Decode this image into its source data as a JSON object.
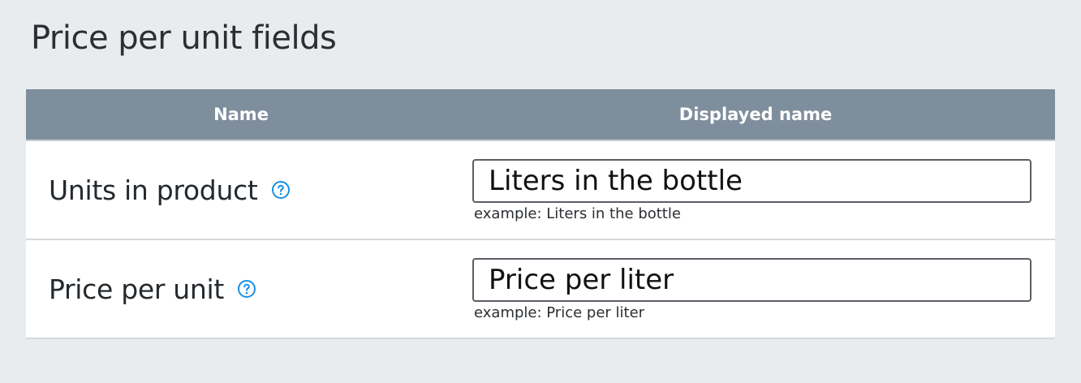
{
  "page": {
    "title": "Price per unit fields"
  },
  "table": {
    "columns": {
      "name": "Name",
      "displayed_name": "Displayed name"
    },
    "rows": [
      {
        "name": "Units in product",
        "help_icon": "question-circle-icon",
        "value": "Liters in the bottle",
        "example": "example: Liters in the bottle"
      },
      {
        "name": "Price per unit",
        "help_icon": "question-circle-icon",
        "value": "Price per liter",
        "example": "example: Price per liter"
      }
    ]
  },
  "colors": {
    "page_background": "#e9ecef",
    "header_background": "#7f8e9d",
    "header_text": "#ffffff",
    "help_icon": "#1a8fe3",
    "row_border": "#d5d8dc",
    "input_border": "#5a5f66"
  }
}
